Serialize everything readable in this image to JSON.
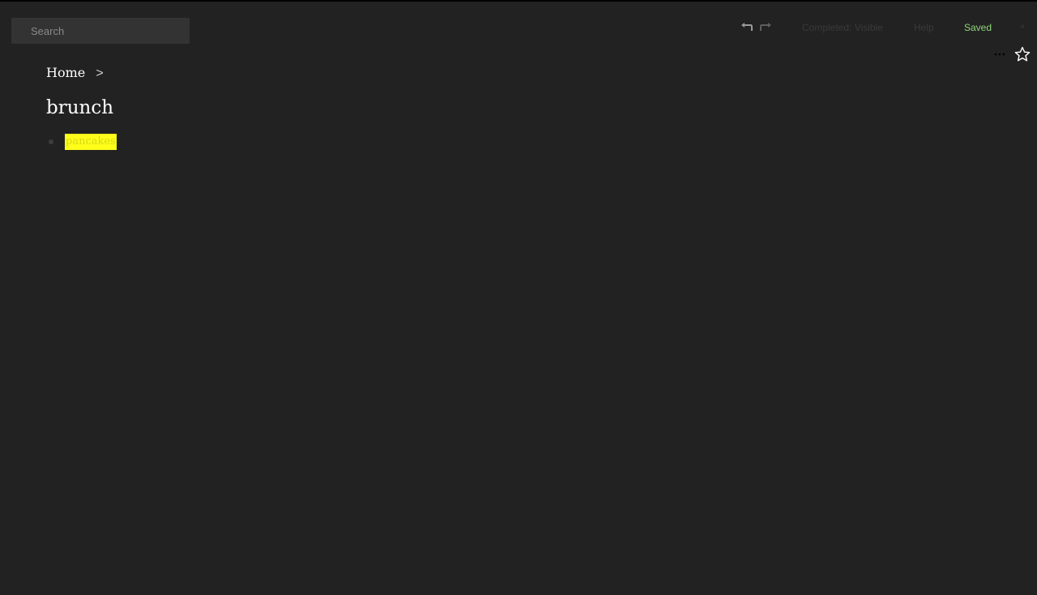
{
  "search": {
    "placeholder": "Search",
    "value": ""
  },
  "toolbar": {
    "undo_icon": "undo-icon",
    "redo_icon": "redo-icon",
    "completed_label": "Completed: Visible",
    "help_label": "Help",
    "status_label": "Saved",
    "close_label": "×",
    "more_icon": "more-horizontal-icon",
    "star_icon": "star-icon"
  },
  "breadcrumb": {
    "items": [
      {
        "label": "Home"
      }
    ],
    "separator": ">"
  },
  "page": {
    "title": "brunch"
  },
  "list": {
    "items": [
      {
        "text": "pancakes",
        "highlight_color": "#ffff1a"
      }
    ]
  },
  "colors": {
    "background": "#222222",
    "saved": "#8fd67a",
    "highlight": "#ffff1a",
    "faded_text": "#3a3a3a"
  }
}
